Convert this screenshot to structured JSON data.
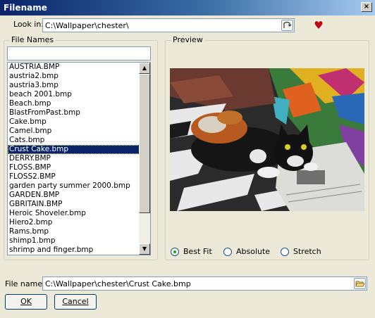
{
  "window": {
    "title": "Filename",
    "close_glyph": "×"
  },
  "look_in": {
    "label": "Look in:",
    "path": "C:\\Wallpaper\\chester\\"
  },
  "file_names": {
    "group_label": "File Names",
    "filter_value": "",
    "items": [
      "AUSTRIA.BMP",
      "austria2.bmp",
      "austria3.bmp",
      "beach 2001.bmp",
      "Beach.bmp",
      "BlastFromPast.bmp",
      "Cake.bmp",
      "Camel.bmp",
      "Cats.bmp",
      "Crust Cake.bmp",
      "DERRY.BMP",
      "FLOSS.BMP",
      "FLOSS2.BMP",
      "garden party summer 2000.bmp",
      "GARDEN.BMP",
      "GBRITAIN.BMP",
      "Heroic Shoveler.bmp",
      "Hiero2.bmp",
      "Rams.bmp",
      "shimp1.bmp",
      "shrimp and finger.bmp"
    ],
    "selected_index": 9
  },
  "preview": {
    "group_label": "Preview",
    "fit_options": [
      "Best Fit",
      "Absolute",
      "Stretch"
    ],
    "selected_fit": "Best Fit"
  },
  "file_name": {
    "label": "File name:",
    "value": "C:\\Wallpaper\\chester\\Crust Cake.bmp"
  },
  "buttons": {
    "ok": "OK",
    "cancel": "Cancel"
  },
  "icons": {
    "browse": "browse-folder-icon",
    "favorite": "heart-icon",
    "open_folder": "open-folder-icon"
  },
  "colors": {
    "title_gradient_start": "#0a246a",
    "selection": "#0a246a",
    "heart": "#c00010"
  }
}
